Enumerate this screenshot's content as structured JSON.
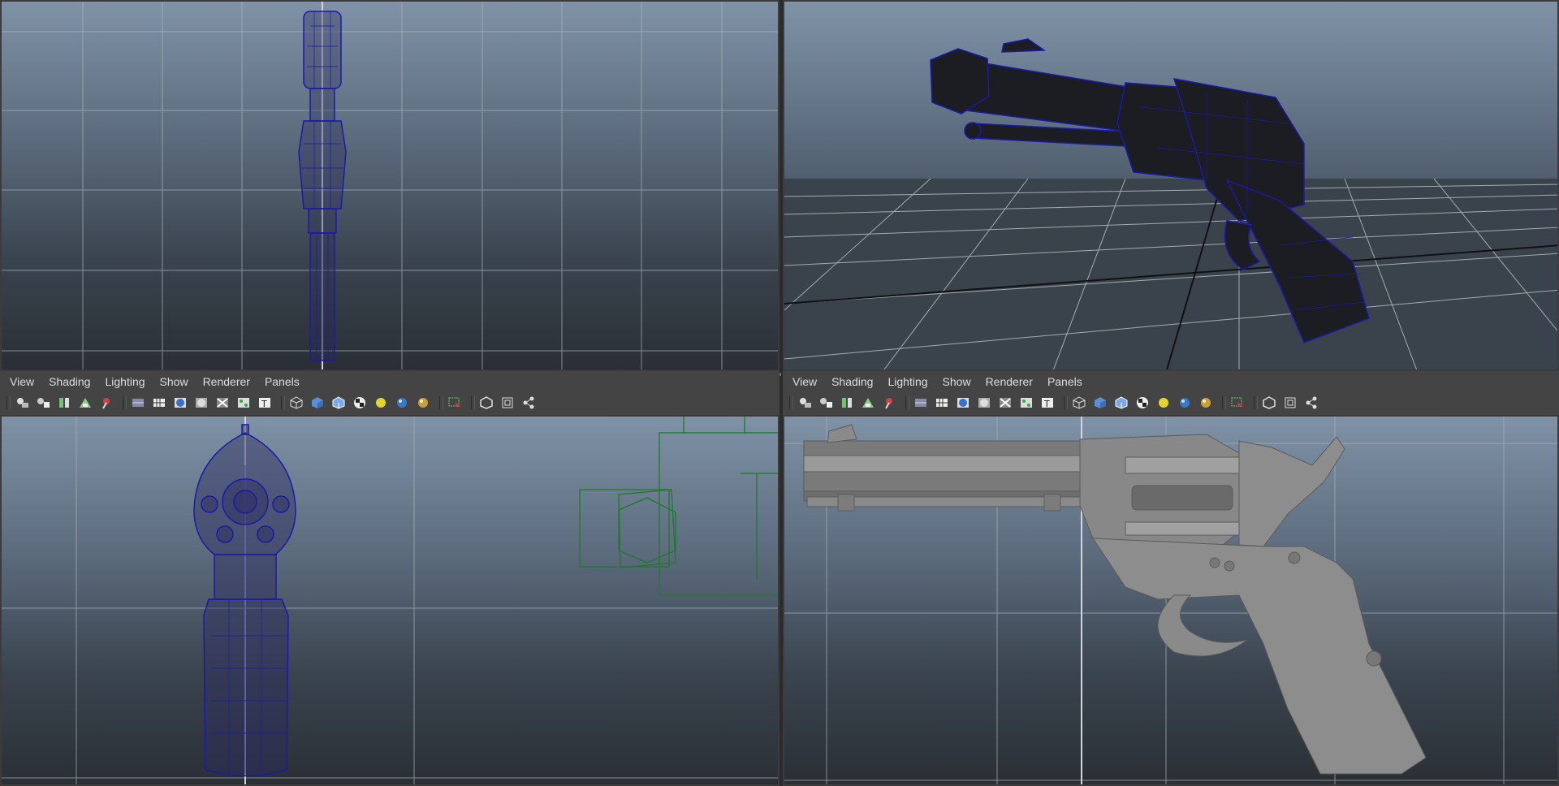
{
  "panels": {
    "left": {
      "menu": [
        "View",
        "Shading",
        "Lighting",
        "Show",
        "Renderer",
        "Panels"
      ]
    },
    "right": {
      "menu": [
        "View",
        "Shading",
        "Lighting",
        "Show",
        "Renderer",
        "Panels"
      ]
    }
  },
  "toolbar_icons": [
    "camera-icon",
    "camera-attributes-icon",
    "bookmark-icon",
    "image-plane-icon",
    "camera-pan-icon",
    "sep",
    "wireframe-icon",
    "grid-toggle-icon",
    "smooth-shade-icon",
    "flat-shade-icon",
    "xray-icon",
    "xray-joints-icon",
    "textured-icon",
    "sep",
    "wire-cube-icon",
    "shaded-cube-icon",
    "shaded-wire-cube-icon",
    "checker-icon",
    "default-light-icon",
    "all-lights-icon",
    "shadows-icon",
    "sep",
    "select-icon",
    "sep",
    "isolate-icon",
    "frame-icon",
    "node-share-icon"
  ],
  "colors": {
    "wireframe_blue": "#1a1aa8",
    "wireframe_green": "#1c7a2a",
    "model_gray": "#8d8d8d",
    "viewport_top": "#7f92a6",
    "viewport_bottom": "#2a2f34"
  }
}
